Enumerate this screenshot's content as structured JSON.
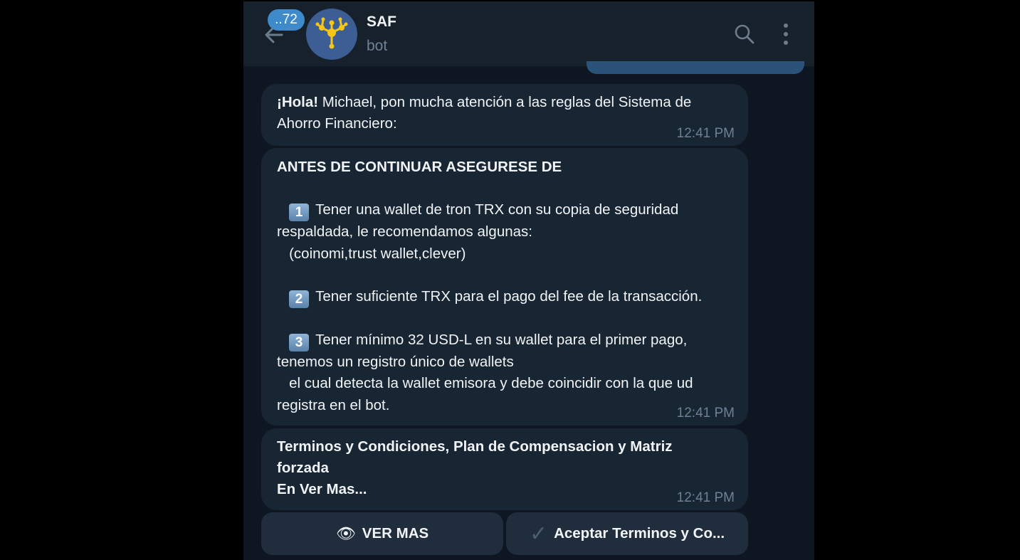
{
  "header": {
    "unread_count": "..72",
    "title": "SAF",
    "subtitle": "bot"
  },
  "messages": [
    {
      "bold_lead": "¡Hola!",
      "text_lines": [
        " Michael, pon mucha atención a las reglas del Sistema de",
        "Ahorro Financiero:"
      ],
      "time": "12:41 PM"
    },
    {
      "heading": "ANTES DE CONTINUAR ASEGURESE DE",
      "keycaps": [
        "1",
        "2",
        "3"
      ],
      "lines": [
        "Tener una wallet de tron TRX con su copia de seguridad",
        "respaldada, le recomendamos algunas:",
        "   (coinomi,trust wallet,clever)",
        "Tener suficiente TRX para el pago del fee de la transacción.",
        "Tener mínimo 32 USD-L en su wallet para el primer pago,",
        "tenemos un registro único de wallets",
        "   el cual detecta la wallet emisora y debe coincidir con la que ud",
        "registra en el bot."
      ],
      "time": "12:41 PM"
    },
    {
      "bold_lines": [
        "Terminos y Condiciones, Plan de Compensacion y Matriz",
        "forzada",
        "En Ver Mas..."
      ],
      "time": "12:41 PM"
    }
  ],
  "buttons": [
    {
      "icon": "eye-icon",
      "label": "VER MAS"
    },
    {
      "icon": "checkmark-icon",
      "label": "Aceptar Terminos y Co..."
    }
  ],
  "colors": {
    "background": "#0e1621",
    "header": "#17212b",
    "bubble": "#182533",
    "accent": "#3e8acb",
    "timestamp": "#6d8094"
  }
}
